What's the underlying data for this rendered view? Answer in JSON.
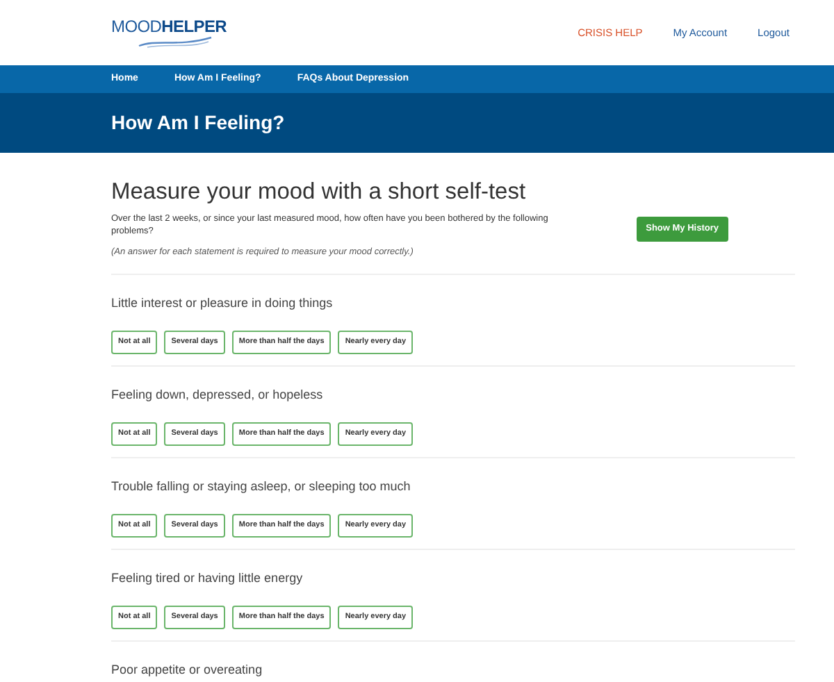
{
  "logo": {
    "part_1": "MOOD",
    "part_2": "HELPER"
  },
  "top_links": [
    {
      "label": "CRISIS HELP",
      "kind": "alert"
    },
    {
      "label": "My Account",
      "kind": "plain"
    },
    {
      "label": "Logout",
      "kind": "plain"
    }
  ],
  "nav": [
    "Home",
    "How Am I Feeling?",
    "FAQs About Depression"
  ],
  "banner": {
    "title": "How Am I Feeling?"
  },
  "intro": {
    "title": "Measure your mood with a short self-test",
    "text": "Over the last 2 weeks, or since your last measured mood, how often have you been bothered by the following problems?",
    "note": "(An answer for each statement is required to measure your mood correctly.)",
    "button": "Show My History"
  },
  "questions": [
    {
      "text": "Little interest or pleasure in doing things",
      "options": [
        {
          "label": "Not at all",
          "selected": false
        },
        {
          "label": "Several days",
          "selected": false
        },
        {
          "label": "More than half the days",
          "selected": false
        },
        {
          "label": "Nearly every day",
          "selected": false
        }
      ]
    },
    {
      "text": "Feeling down, depressed, or hopeless",
      "options": [
        {
          "label": "Not at all",
          "selected": false
        },
        {
          "label": "Several days",
          "selected": false
        },
        {
          "label": "More than half the days",
          "selected": false
        },
        {
          "label": "Nearly every day",
          "selected": false
        }
      ]
    },
    {
      "text": "Trouble falling or staying asleep, or sleeping too much",
      "options": [
        {
          "label": "Not at all",
          "selected": false
        },
        {
          "label": "Several days",
          "selected": false
        },
        {
          "label": "More than half the days",
          "selected": false
        },
        {
          "label": "Nearly every day",
          "selected": false
        }
      ]
    },
    {
      "text": "Feeling tired or having little energy",
      "options": [
        {
          "label": "Not at all",
          "selected": false
        },
        {
          "label": "Several days",
          "selected": false
        },
        {
          "label": "More than half the days",
          "selected": false
        },
        {
          "label": "Nearly every day",
          "selected": false
        }
      ]
    },
    {
      "text": "Poor appetite or overeating"
    }
  ]
}
